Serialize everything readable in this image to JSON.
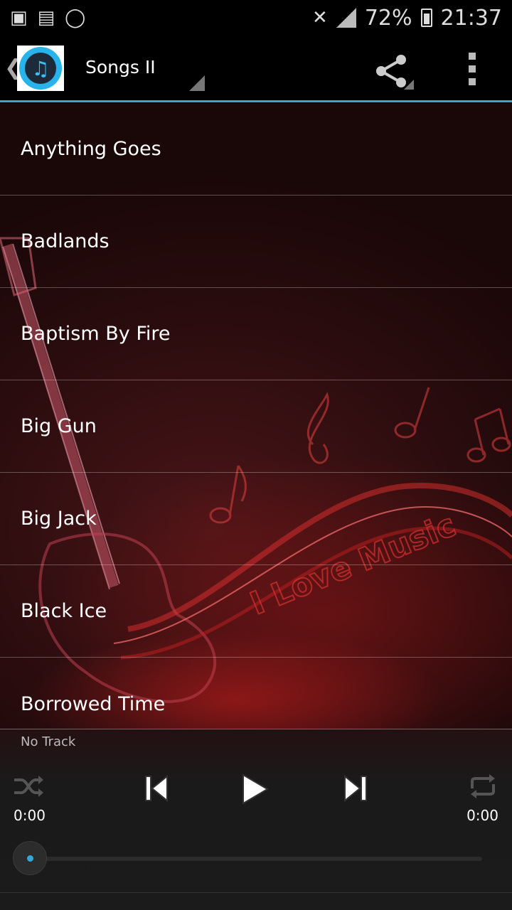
{
  "status_bar": {
    "battery": "72%",
    "time": "21:37",
    "icons": [
      "image-icon",
      "bbm-icon",
      "whatsapp-icon",
      "mute-icon",
      "signal-icon",
      "battery-icon"
    ]
  },
  "action_bar": {
    "title": "Songs II",
    "icons": [
      "back-icon",
      "app-music-icon",
      "share-icon",
      "overflow-menu-icon"
    ]
  },
  "songs": [
    {
      "title": "Anything Goes"
    },
    {
      "title": "Badlands"
    },
    {
      "title": "Baptism By Fire"
    },
    {
      "title": "Big Gun"
    },
    {
      "title": "Big Jack"
    },
    {
      "title": "Black Ice"
    },
    {
      "title": "Borrowed Time"
    }
  ],
  "background_text": "I Love Music",
  "player": {
    "track": "No Track",
    "elapsed": "0:00",
    "duration": "0:00",
    "progress": 0,
    "controls": [
      "shuffle-icon",
      "previous-icon",
      "play-icon",
      "next-icon",
      "repeat-icon"
    ]
  },
  "colors": {
    "accent": "#35a8d8",
    "background": "#000000",
    "list_bg": "#3a1012"
  }
}
